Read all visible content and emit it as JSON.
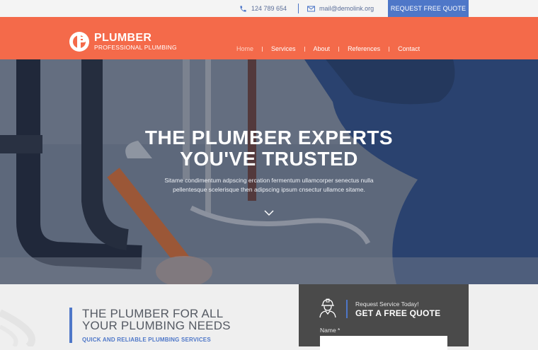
{
  "topbar": {
    "phone": "124 789 654",
    "email": "mail@demolink.org",
    "quote_button": "REQUEST FREE QUOTE"
  },
  "brand": {
    "title": "PLUMBER",
    "subtitle": "PROFESSIONAL PLUMBING"
  },
  "nav": {
    "items": [
      {
        "label": "Home",
        "active": true
      },
      {
        "label": "Services"
      },
      {
        "label": "About"
      },
      {
        "label": "References"
      },
      {
        "label": "Contact"
      }
    ]
  },
  "hero": {
    "title_line1": "THE PLUMBER EXPERTS",
    "title_line2": "YOU'VE TRUSTED",
    "text_line1": "Sitame condimentum adpscing ercation fermentum ullamcorper senectus nulla",
    "text_line2": "pellentesque scelerisque then adipscing ipsum cnsectur ullamce sitame."
  },
  "intro": {
    "heading_line1": "THE PLUMBER FOR ALL",
    "heading_line2": "YOUR PLUMBING NEEDS",
    "tagline": "QUICK AND RELIABLE PLUMBING SERVICES"
  },
  "quote_form": {
    "kicker": "Request Service Today!",
    "title": "GET A FREE QUOTE",
    "name_label": "Name *",
    "name_value": ""
  },
  "colors": {
    "header": "#f46a4a",
    "accent": "#4e77c8",
    "panel": "#4a4a4a"
  }
}
